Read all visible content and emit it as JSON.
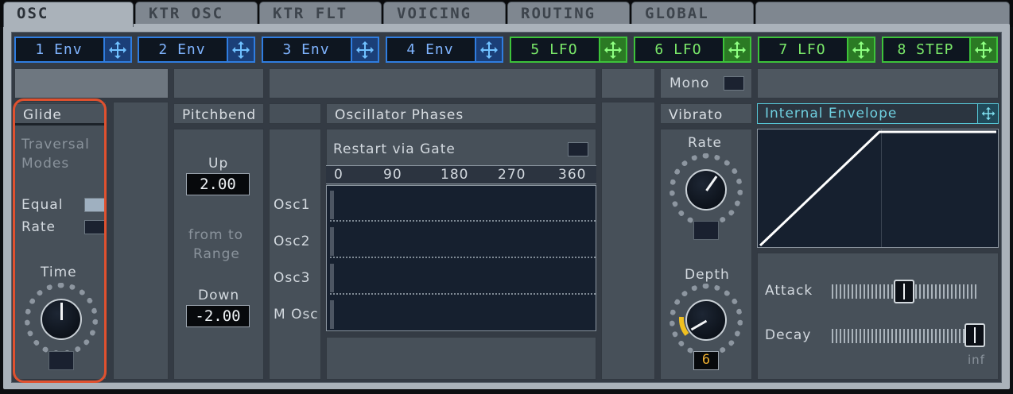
{
  "tabs": [
    "OSC",
    "KTR OSC",
    "KTR FLT",
    "VOICING",
    "ROUTING",
    "GLOBAL"
  ],
  "active_tab": "OSC",
  "modulators": [
    {
      "label": "1 Env",
      "type": "env"
    },
    {
      "label": "2 Env",
      "type": "env"
    },
    {
      "label": "3 Env",
      "type": "env"
    },
    {
      "label": "4 Env",
      "type": "env"
    },
    {
      "label": "5 LFO",
      "type": "lfo"
    },
    {
      "label": "6 LFO",
      "type": "lfo"
    },
    {
      "label": "7 LFO",
      "type": "lfo"
    },
    {
      "label": "8 STEP",
      "type": "step"
    }
  ],
  "mono": {
    "label": "Mono"
  },
  "glide": {
    "title": "Glide",
    "traversal_line1": "Traversal",
    "traversal_line2": "Modes",
    "equal_label": "Equal",
    "rate_label": "Rate",
    "equal_on": true,
    "rate_on": false,
    "time_label": "Time"
  },
  "pitchbend": {
    "title": "Pitchbend",
    "up_label": "Up",
    "up_value": "2.00",
    "range_line1": "from to",
    "range_line2": "Range",
    "down_label": "Down",
    "down_value": "-2.00"
  },
  "osc_phases": {
    "title": "Oscillator Phases",
    "restart_label": "Restart via Gate",
    "scale": [
      "0",
      "90",
      "180",
      "270",
      "360"
    ],
    "rows": [
      "Osc1",
      "Osc2",
      "Osc3",
      "M Osc"
    ]
  },
  "vibrato": {
    "title": "Vibrato",
    "rate_label": "Rate",
    "depth_label": "Depth",
    "depth_value": "6"
  },
  "envelope": {
    "title": "Internal Envelope",
    "attack_label": "Attack",
    "decay_label": "Decay",
    "decay_end_label": "inf",
    "attack_level": 0.5,
    "decay_level": 1.0
  },
  "colors": {
    "env_accent": "#2f7de0",
    "lfo_accent": "#3dc33a",
    "highlight": "#e0512f",
    "depth_arc": "#f0c020"
  }
}
